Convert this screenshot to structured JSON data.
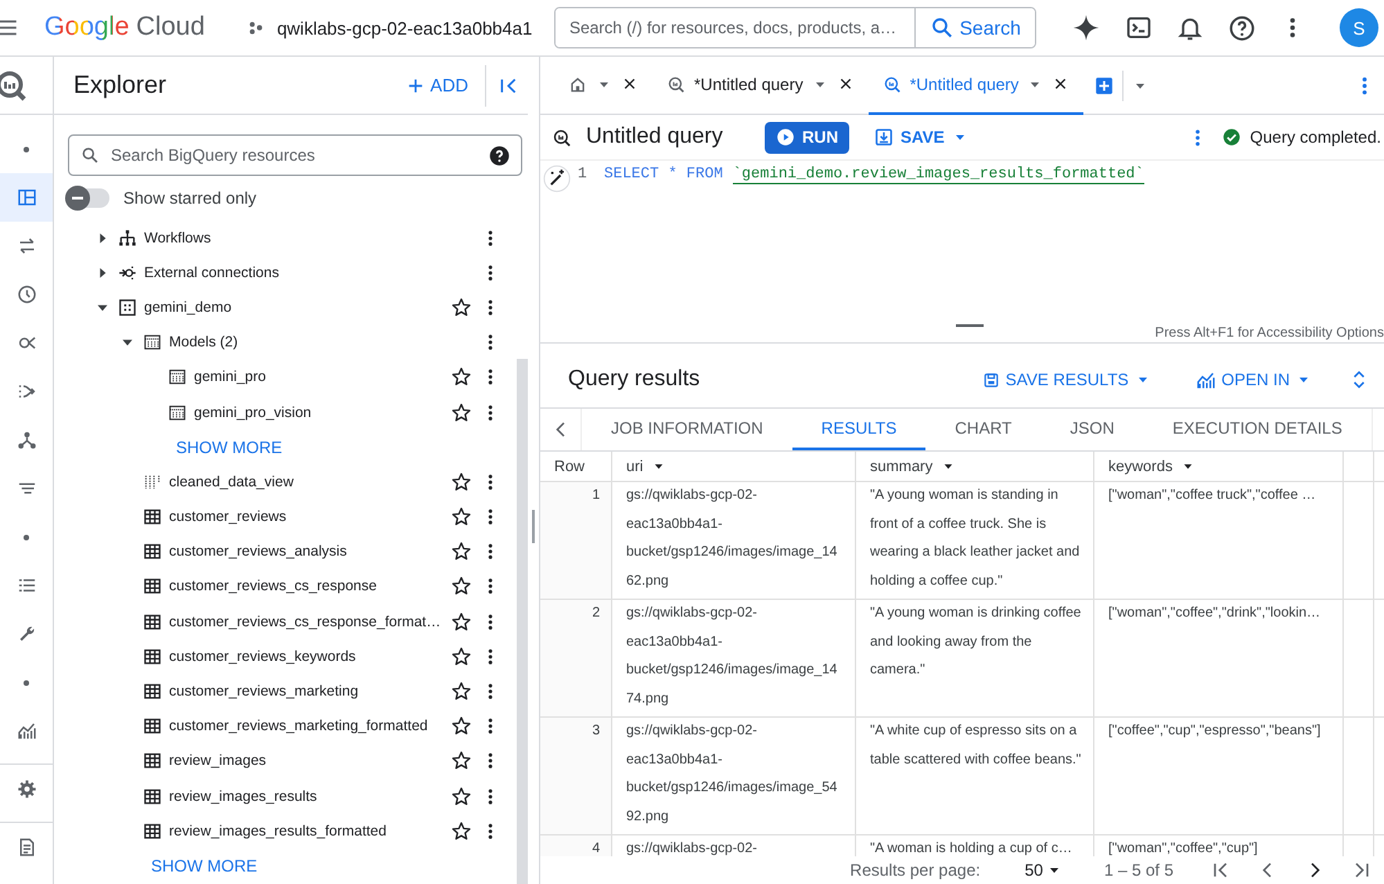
{
  "topbar": {
    "logo_google": "Google",
    "logo_cloud": "Cloud",
    "project": "qwiklabs-gcp-02-eac13a0bb4a1",
    "search": {
      "placeholder": "Search (/) for resources, docs, products, a…"
    },
    "search_button": "Search",
    "avatar": "S"
  },
  "rail": [
    {
      "kind": "dot",
      "selected": false
    },
    {
      "kind": "panel",
      "selected": true
    },
    {
      "kind": "transfer",
      "selected": false
    },
    {
      "kind": "history",
      "selected": false
    },
    {
      "kind": "analytics",
      "selected": false
    },
    {
      "kind": "pipeline",
      "selected": false
    },
    {
      "kind": "hierarchy",
      "selected": false
    },
    {
      "kind": "filter",
      "selected": false
    },
    {
      "kind": "dot",
      "selected": false
    },
    {
      "kind": "list",
      "selected": false
    },
    {
      "kind": "wrench",
      "selected": false
    },
    {
      "kind": "dot",
      "selected": false
    },
    {
      "kind": "chart",
      "selected": false
    },
    {
      "kind": "settings",
      "selected": false
    },
    {
      "kind": "notes",
      "selected": false
    }
  ],
  "explorer": {
    "title": "Explorer",
    "add": "ADD",
    "search": {
      "placeholder": "Search BigQuery resources"
    },
    "starred_toggle": {
      "label": "Show starred only",
      "on": false
    },
    "tree": [
      {
        "kind": "workflows",
        "label": "Workflows",
        "expanded": false
      },
      {
        "kind": "connections",
        "label": "External connections",
        "expanded": false
      },
      {
        "kind": "dataset",
        "label": "gemini_demo",
        "expanded": true,
        "starred": false,
        "children": [
          {
            "kind": "models",
            "label": "Models (2)",
            "expanded": true,
            "children": [
              {
                "kind": "model",
                "label": "gemini_pro",
                "starred": false
              },
              {
                "kind": "model",
                "label": "gemini_pro_vision",
                "starred": false
              },
              {
                "kind": "more",
                "label": "SHOW MORE"
              }
            ]
          },
          {
            "kind": "view",
            "label": "cleaned_data_view",
            "starred": false
          },
          {
            "kind": "table",
            "label": "customer_reviews",
            "starred": false
          },
          {
            "kind": "table",
            "label": "customer_reviews_analysis",
            "starred": false
          },
          {
            "kind": "table",
            "label": "customer_reviews_cs_response",
            "starred": false
          },
          {
            "kind": "table",
            "label": "customer_reviews_cs_response_format…",
            "starred": false
          },
          {
            "kind": "table",
            "label": "customer_reviews_keywords",
            "starred": false
          },
          {
            "kind": "table",
            "label": "customer_reviews_marketing",
            "starred": false
          },
          {
            "kind": "table",
            "label": "customer_reviews_marketing_formatted",
            "starred": false
          },
          {
            "kind": "table",
            "label": "review_images",
            "starred": false
          },
          {
            "kind": "table",
            "label": "review_images_results",
            "starred": false
          },
          {
            "kind": "table",
            "label": "review_images_results_formatted",
            "starred": false
          },
          {
            "kind": "more",
            "label": "SHOW MORE"
          }
        ]
      }
    ]
  },
  "workspace": {
    "tabs": [
      {
        "kind": "home",
        "selected": false
      },
      {
        "kind": "query",
        "label": "*Untitled query",
        "selected": false
      },
      {
        "kind": "query",
        "label": "*Untitled query",
        "selected": true
      }
    ],
    "query": {
      "title": "Untitled query",
      "run": "RUN",
      "save": "SAVE",
      "status": "Query completed."
    },
    "editor": {
      "line_number": "1",
      "keyword": "SELECT * FROM",
      "table_ref": "`gemini_demo.review_images_results_formatted`",
      "hint": "Press Alt+F1 for Accessibility Options"
    },
    "results": {
      "title": "Query results",
      "save_results": "SAVE RESULTS",
      "open_in": "OPEN IN",
      "tabs": [
        {
          "label": "JOB INFORMATION",
          "selected": false
        },
        {
          "label": "RESULTS",
          "selected": true
        },
        {
          "label": "CHART",
          "selected": false
        },
        {
          "label": "JSON",
          "selected": false
        },
        {
          "label": "EXECUTION DETAILS",
          "selected": false
        }
      ],
      "table": {
        "columns": [
          "Row",
          "uri",
          "summary",
          "keywords"
        ],
        "rows": [
          [
            "1",
            "gs://qwiklabs-gcp-02-eac13a0bb4a1-bucket/gsp1246/images/image_1462.png",
            "\"A young woman is standing in front of a coffee truck. She is wearing a black leather jacket and holding a coffee cup.\"",
            "[\"woman\",\"coffee truck\",\"coffee …"
          ],
          [
            "2",
            "gs://qwiklabs-gcp-02-eac13a0bb4a1-bucket/gsp1246/images/image_1474.png",
            "\"A young woman is drinking coffee and looking away from the camera.\"",
            "[\"woman\",\"coffee\",\"drink\",\"lookin…"
          ],
          [
            "3",
            "gs://qwiklabs-gcp-02-eac13a0bb4a1-bucket/gsp1246/images/image_5492.png",
            "\"A white cup of espresso sits on a table scattered with coffee beans.\"",
            "[\"coffee\",\"cup\",\"espresso\",\"beans\"]"
          ],
          [
            "4",
            "gs://qwiklabs-gcp-02-",
            "\"A woman is holding a cup of c…",
            "[\"woman\",\"coffee\",\"cup\"]"
          ]
        ]
      },
      "pagination": {
        "per_page_label": "Results per page:",
        "per_page": "50",
        "range": "1 – 5 of 5"
      }
    }
  }
}
